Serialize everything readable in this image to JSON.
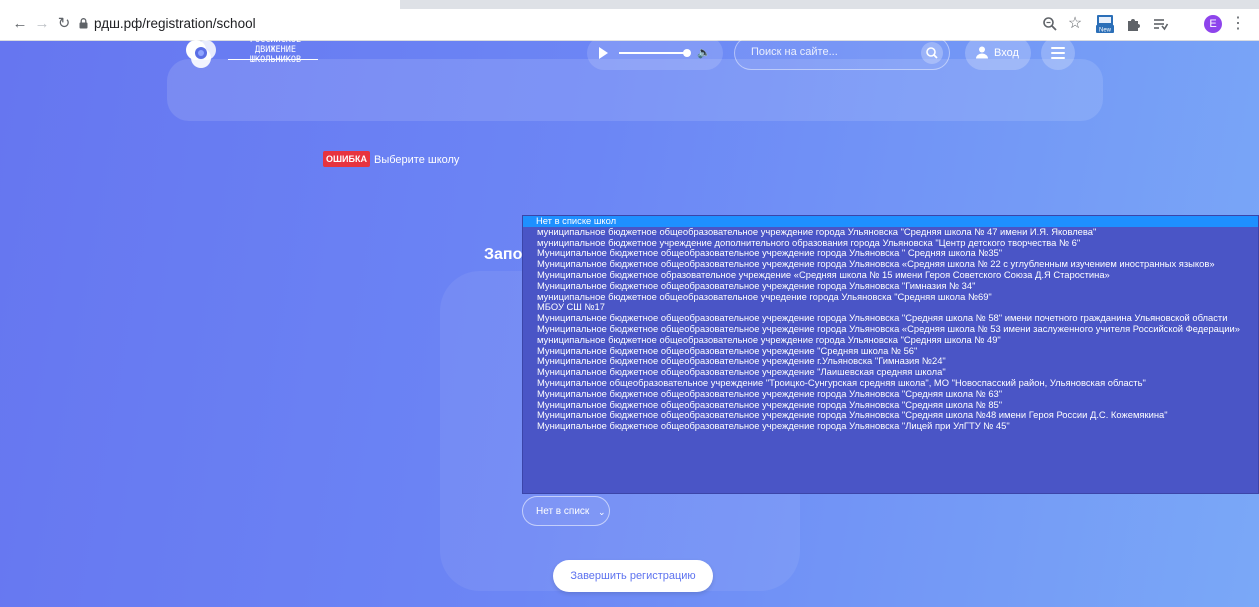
{
  "browser": {
    "url": "рдш.рф/registration/school",
    "extension_new_label": "New",
    "profile_initial": "E",
    "icons": [
      "back-icon",
      "forward-icon",
      "reload-icon",
      "lock-icon",
      "zoom-icon",
      "star-icon",
      "extension-new-icon",
      "puzzle-icon",
      "reading-list-icon",
      "profile-avatar",
      "more-icon"
    ]
  },
  "header": {
    "logo_line1": "РОССИЙСКОЕ",
    "logo_line2": "ДВИЖЕНИЕ ШКОЛЬНИКОВ",
    "search_placeholder": "Поиск на сайте...",
    "login_label": "Вход"
  },
  "error": {
    "badge": "ОШИБКА",
    "message": "Выберите школу"
  },
  "form": {
    "title": "Запо",
    "select_value": "Нет в списк",
    "submit_label": "Завершить регистрацию"
  },
  "dropdown": {
    "selected_index": 0,
    "options": [
      "Нет в списке школ",
      "муниципальное бюджетное общеобразовательное учреждение города Ульяновска \"Средняя школа № 47 имени И.Я. Яковлева\"",
      "муниципальное бюджетное учреждение дополнительного образования города Ульяновска \"Центр детского творчества № 6\"",
      "Муниципальное бюджетное общеобразовательное учреждение города Ульяновска \" Средняя школа №35\"",
      "Муниципальное бюджетное общеобразовательное учреждение города Ульяновска «Средняя школа № 22 с углубленным изучением иностранных языков»",
      "Муниципальное бюджетное образовательное учреждение «Средняя школа № 15 имени Героя Советского Союза Д.Я Старостина»",
      "Муниципальное бюджетное общеобразовательное учреждение города Ульяновска \"Гимназия № 34\"",
      "муниципальное бюджетное общеобразовательное учредение города Ульяновска \"Средняя школа №69\"",
      "МБОУ СШ №17",
      "Муниципальное бюджетное общеобразовательное учреждение города Ульяновска \"Средняя школа № 58\" имени почетного гражданина Ульяновской области",
      "Муниципальное бюджетное общеобразовательное учреждение города Ульяновска «Средняя школа № 53 имени заслуженного учителя Российской Федерации»",
      "муниципальное бюджетное общеобразовательное учреждение города Ульяновска \"Средняя школа № 49\"",
      "Муниципальное бюджетное общеобразовательное учреждение \"Средняя школа № 56\"",
      "Муниципальное бюджетное общеобразовательное учреждение г.Ульяновска \"Гимназия №24\"",
      "Муниципальное бюджетное общеобразовательное учреждение \"Лаишевская средняя школа\"",
      "Муниципальное общеобразовательное учреждение \"Троицко-Сунгурская средняя школа\", МО \"Новоспасский район, Ульяновская область\"",
      "Муниципальное бюджетное общеобразовательное учреждение города Ульяновска \"Средняя школа № 63\"",
      "Муниципальное бюджетное общеобразовательное учреждение города Ульяновска \"Средняя школа № 85\"",
      "Муниципальное бюджетное общеобразовательное учреждение города Ульяновска \"Средняя школа №48 имени Героя России Д.С. Кожемякина\"",
      "Муниципальное бюджетное общеобразовательное учреждение города Ульяновска \"Лицей при УлГТУ № 45\""
    ]
  }
}
